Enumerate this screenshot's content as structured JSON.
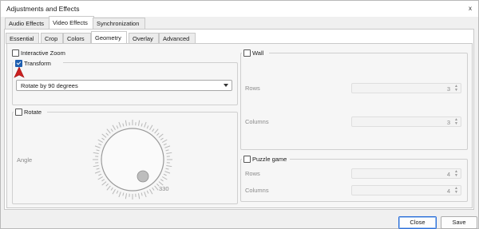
{
  "window": {
    "title": "Adjustments and Effects",
    "close_glyph": "x"
  },
  "main_tabs": [
    "Audio Effects",
    "Video Effects",
    "Synchronization"
  ],
  "main_tab_active": "Video Effects",
  "sub_tabs": [
    "Essential",
    "Crop",
    "Colors",
    "Geometry",
    "Overlay",
    "Advanced"
  ],
  "sub_tab_active": "Geometry",
  "geometry": {
    "interactive_zoom": {
      "label": "Interactive Zoom",
      "checked": false
    },
    "transform": {
      "label": "Transform",
      "checked": true,
      "select_value": "Rotate by 90 degrees"
    },
    "rotate": {
      "label": "Rotate",
      "checked": false,
      "angle_label": "Angle",
      "dial_value": "330"
    },
    "wall": {
      "label": "Wall",
      "checked": false,
      "rows_label": "Rows",
      "rows_value": "3",
      "columns_label": "Columns",
      "columns_value": "3"
    },
    "puzzle": {
      "label": "Puzzle game",
      "checked": false,
      "rows_label": "Rows",
      "rows_value": "4",
      "columns_label": "Columns",
      "columns_value": "4"
    }
  },
  "buttons": {
    "close": "Close",
    "save": "Save"
  },
  "colors": {
    "accent": "#1f5fb0",
    "pointer": "#cc2020",
    "primary_border": "#2e6fd8"
  },
  "icons": {
    "pointer": "red-arrow-pointer-icon",
    "spin": "spin-arrows-icon",
    "dropdown": "chevron-down-icon"
  }
}
